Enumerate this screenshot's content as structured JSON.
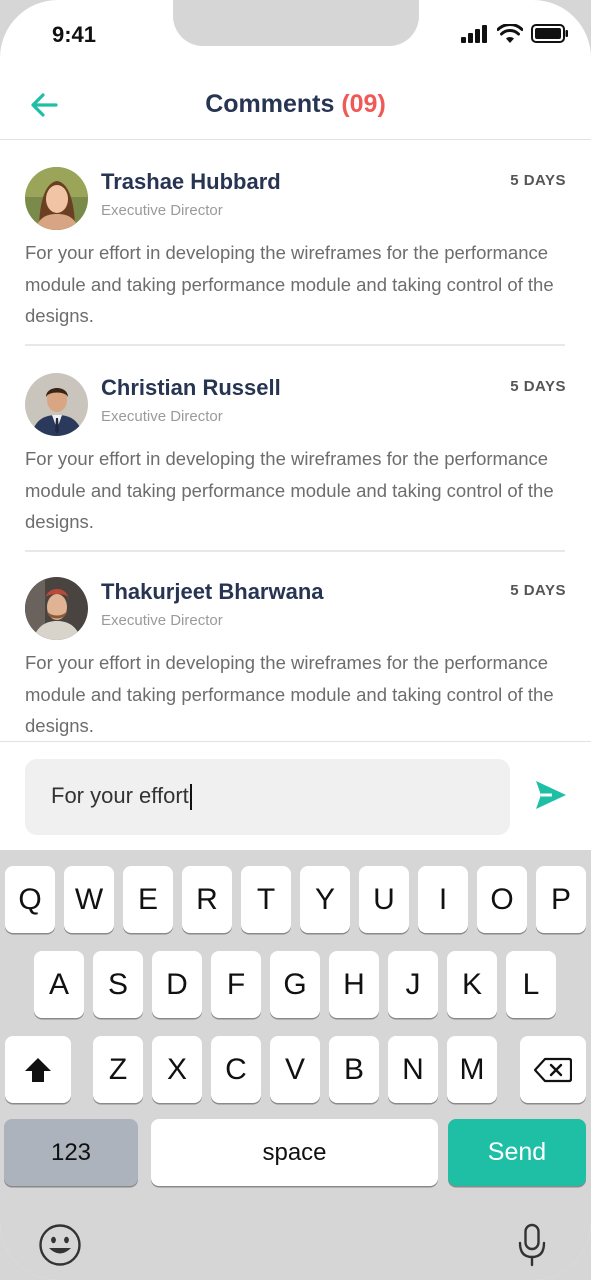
{
  "status": {
    "time": "9:41"
  },
  "header": {
    "title": "Comments",
    "count": "(09)"
  },
  "comments": [
    {
      "name": "Trashae Hubbard",
      "role": "Executive Director",
      "time": "5 DAYS",
      "text": "For your effort in developing the wireframes for the performance module and taking performance module and taking control of the designs."
    },
    {
      "name": "Christian Russell",
      "role": "Executive Director",
      "time": "5 DAYS",
      "text": "For your effort in developing the wireframes for the performance module and taking performance module and taking control of the designs."
    },
    {
      "name": "Thakurjeet Bharwana",
      "role": "Executive Director",
      "time": "5 DAYS",
      "text": "For your effort in developing the wireframes for the performance module and taking performance module and taking control of the designs."
    }
  ],
  "composer": {
    "value": "For your effort"
  },
  "keyboard": {
    "row1": [
      "Q",
      "W",
      "E",
      "R",
      "T",
      "Y",
      "U",
      "I",
      "O",
      "P"
    ],
    "row2": [
      "A",
      "S",
      "D",
      "F",
      "G",
      "H",
      "J",
      "K",
      "L"
    ],
    "row3": [
      "Z",
      "X",
      "C",
      "V",
      "B",
      "N",
      "M"
    ],
    "numbers_label": "123",
    "space_label": "space",
    "send_label": "Send"
  },
  "colors": {
    "accent": "#1ebfa5",
    "count": "#ef5a56",
    "title": "#273553"
  }
}
